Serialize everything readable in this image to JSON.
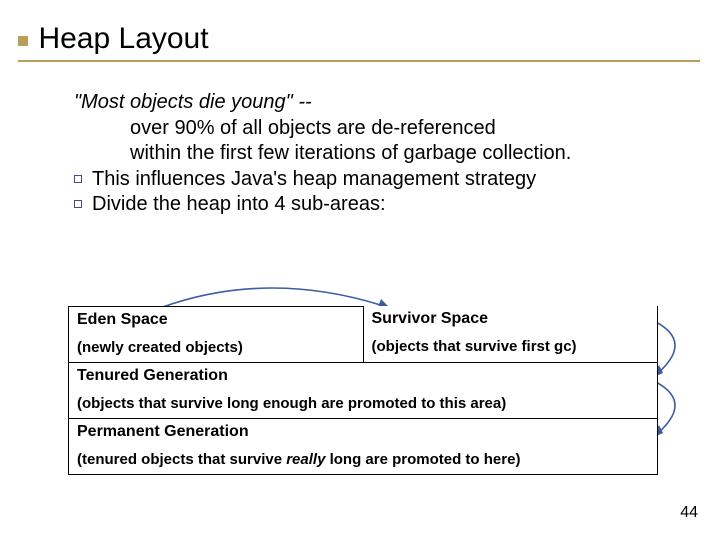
{
  "title": "Heap Layout",
  "quote_line": "\"Most objects die young\" --",
  "indent1": "over 90% of all objects are de-referenced",
  "indent2": "within the first few iterations of garbage collection.",
  "bullet1": "This influences Java's heap management strategy",
  "bullet2": "Divide the heap into 4 sub-areas:",
  "areas": {
    "eden": {
      "name": "Eden Space",
      "desc": "(newly created objects)"
    },
    "survivor": {
      "name": "Survivor Space",
      "desc": "(objects that survive first gc)"
    },
    "tenured": {
      "name": "Tenured Generation",
      "desc": "(objects that survive long enough are promoted to this area)"
    },
    "permanent": {
      "name": "Permanent Generation",
      "desc_pre": "(tenured objects that survive ",
      "desc_em": "really",
      "desc_post": " long are promoted to here)"
    }
  },
  "page_number": "44"
}
